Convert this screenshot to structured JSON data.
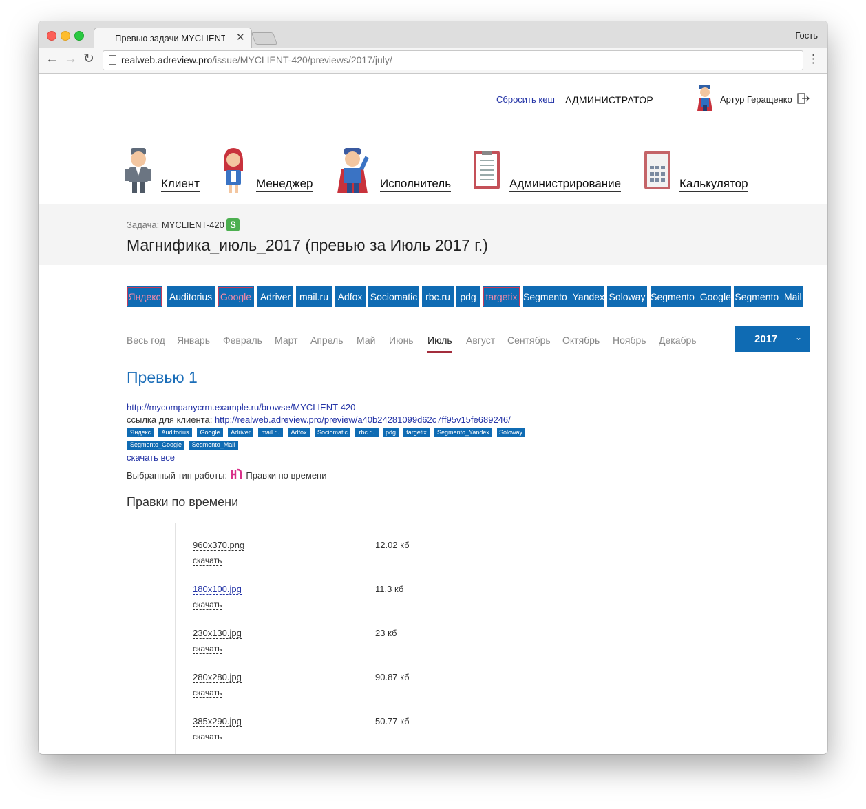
{
  "browser": {
    "tab_title": "Превью задачи MYCLIENT-420",
    "tab_close": "✕",
    "guest_label": "Гость",
    "url_host": "realweb.adreview.pro",
    "url_path": "/issue/MYCLIENT-420/previews/2017/july/"
  },
  "header": {
    "reset_cache": "Сбросить кеш",
    "role": "АДМИНИСТРАТОР",
    "user_name": "Артур Геращенко"
  },
  "menu": [
    {
      "label": "Клиент",
      "icon": "client-avatar-icon"
    },
    {
      "label": "Менеджер",
      "icon": "manager-avatar-icon"
    },
    {
      "label": "Исполнитель",
      "icon": "executor-avatar-icon"
    },
    {
      "label": "Администрирование",
      "icon": "clipboard-icon"
    },
    {
      "label": "Калькулятор",
      "icon": "calculator-icon"
    }
  ],
  "task": {
    "prefix": "Задача:",
    "id": "MYCLIENT-420",
    "badge": "$",
    "title": "Магнифика_июль_2017 (превью за Июль 2017 г.)"
  },
  "sources": [
    "Яндекс",
    "Auditorius",
    "Google",
    "Adriver",
    "mail.ru",
    "Adfox",
    "Sociomatic",
    "rbc.ru",
    "pdg",
    "targetix",
    "Segmento_Yandex",
    "Soloway",
    "Segmento_Google",
    "Segmento_Mail"
  ],
  "months": [
    "Весь год",
    "Январь",
    "Февраль",
    "Март",
    "Апрель",
    "Май",
    "Июнь",
    "Июль",
    "Август",
    "Сентябрь",
    "Октябрь",
    "Ноябрь",
    "Декабрь"
  ],
  "active_month": "Июль",
  "year": "2017",
  "preview": {
    "title": "Превью 1",
    "crm_link": "http://mycompanycrm.example.ru/browse/MYCLIENT-420",
    "client_link_label": "ссылка для клиента:",
    "client_link": "http://realweb.adreview.pro/preview/a40b24281099d62c7ff95v15fe689246/",
    "tags": [
      "Яндекс",
      "Auditorius",
      "Google",
      "Adriver",
      "mail.ru",
      "Adfox",
      "Sociomatic",
      "rbc.ru",
      "pdg",
      "targetix",
      "Segmento_Yandex",
      "Soloway",
      "Segmento_Google",
      "Segmento_Mail"
    ],
    "download_all": "скачать все",
    "worktype_label": "Выбранный тип работы:",
    "worktype_value": "Правки по времени",
    "section_title": "Правки по времени",
    "files": [
      {
        "name": "960x370.png",
        "size": "12.02 кб",
        "download": "скачать"
      },
      {
        "name": "180x100.jpg",
        "size": "11.3 кб",
        "download": "скачать"
      },
      {
        "name": "230x130.jpg",
        "size": "23 кб",
        "download": "скачать"
      },
      {
        "name": "280x280.jpg",
        "size": "90.87 кб",
        "download": "скачать"
      },
      {
        "name": "385x290.jpg",
        "size": "50.77 кб",
        "download": "скачать"
      }
    ]
  },
  "colors": {
    "accent": "#0f6bb3",
    "active_underline": "#a32d3c",
    "link": "#2333a6",
    "badge_green": "#4caf50"
  }
}
